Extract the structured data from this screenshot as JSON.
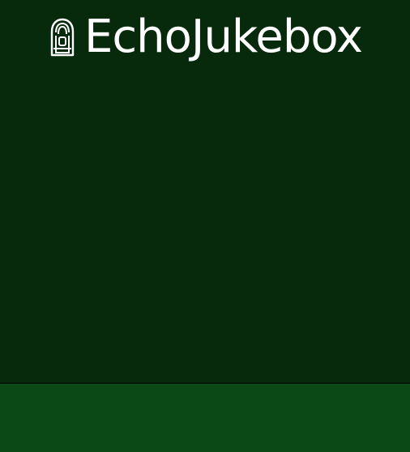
{
  "app": {
    "name": "EchoJukebox",
    "logo_icon": "jukebox-icon",
    "colors": {
      "top_background": "#072a0c",
      "bottom_bar_background": "#0b4a16",
      "divider": "#071a0a",
      "text": "#ffffff"
    }
  }
}
